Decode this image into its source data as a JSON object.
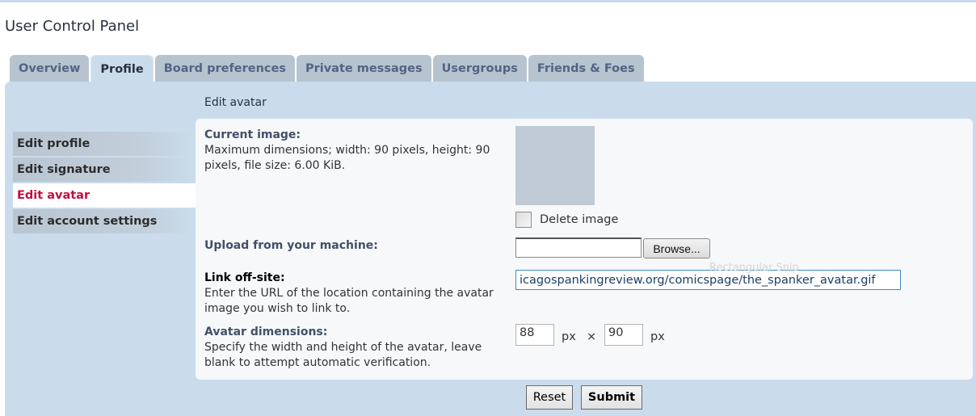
{
  "page": {
    "title": "User Control Panel"
  },
  "tabs": [
    {
      "label": "Overview",
      "active": false
    },
    {
      "label": "Profile",
      "active": true
    },
    {
      "label": "Board preferences",
      "active": false
    },
    {
      "label": "Private messages",
      "active": false
    },
    {
      "label": "Usergroups",
      "active": false
    },
    {
      "label": "Friends & Foes",
      "active": false
    }
  ],
  "sidebar": {
    "items": [
      {
        "label": "Edit profile",
        "active": false
      },
      {
        "label": "Edit signature",
        "active": false
      },
      {
        "label": "Edit avatar",
        "active": true
      },
      {
        "label": "Edit account settings",
        "active": false
      }
    ]
  },
  "section": {
    "title": "Edit avatar"
  },
  "form": {
    "current_image": {
      "label": "Current image:",
      "description": "Maximum dimensions; width: 90 pixels, height: 90 pixels, file size: 6.00 KiB."
    },
    "delete_image": {
      "label": "Delete image",
      "checked": false
    },
    "upload": {
      "label": "Upload from your machine:",
      "value": "",
      "browse_label": "Browse..."
    },
    "link": {
      "label": "Link off-site:",
      "description": "Enter the URL of the location containing the avatar image you wish to link to.",
      "value": "icagospankingreview.org/comicspage/the_spanker_avatar.gif"
    },
    "overlay_text": "Rectangular Snip",
    "dimensions": {
      "label": "Avatar dimensions:",
      "description": "Specify the width and height of the avatar, leave blank to attempt automatic verification.",
      "width": "88",
      "height": "90",
      "unit": "px",
      "separator": "×"
    },
    "buttons": {
      "reset": "Reset",
      "submit": "Submit"
    }
  },
  "colors": {
    "panel_bg": "#cadceb",
    "tab_inactive_bg": "#b7c4d0",
    "tab_inactive_text": "#536482",
    "active_menu_text": "#c30d3f",
    "content_bg": "#f7f8fa",
    "link_input_border": "#3a8ec0"
  }
}
